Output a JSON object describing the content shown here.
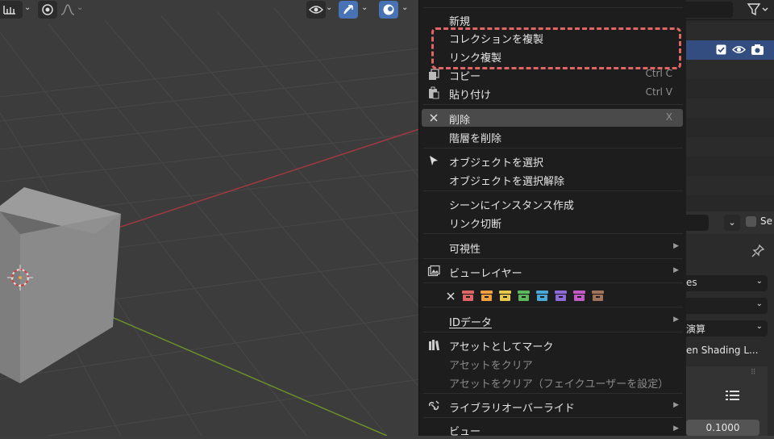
{
  "viewport_header": {
    "icons": [
      "view-icon",
      "chevron-down-icon",
      "gizmo-icon",
      "chevron-down-icon",
      "overlay-icon",
      "chevron-down-icon",
      "proportional-edit-icon",
      "falloff-icon",
      "snapping-icon"
    ]
  },
  "context_menu": {
    "items": {
      "new": {
        "label": "新規"
      },
      "copy_collection": {
        "label": "コレクションを複製"
      },
      "link_duplicate": {
        "label": "リンク複製"
      },
      "copy": {
        "label": "コピー",
        "shortcut": "Ctrl C"
      },
      "paste": {
        "label": "貼り付け",
        "shortcut": "Ctrl V"
      },
      "delete": {
        "label": "削除",
        "shortcut": "X"
      },
      "delete_hierarchy": {
        "label": "階層を削除"
      },
      "select_objects": {
        "label": "オブジェクトを選択"
      },
      "deselect_objects": {
        "label": "オブジェクトを選択解除"
      },
      "instance_to_scene": {
        "label": "シーンにインスタンス作成"
      },
      "unlink": {
        "label": "リンク切断"
      },
      "visibility": {
        "label": "可視性"
      },
      "view_layer": {
        "label": "ビューレイヤー"
      },
      "id_data": {
        "label": "IDデータ"
      },
      "mark_as_asset": {
        "label": "アセットとしてマーク"
      },
      "clear_asset": {
        "label": "アセットをクリア"
      },
      "clear_asset_fake_user": {
        "label": "アセットをクリア（フェイクユーザーを設定）"
      },
      "library_override": {
        "label": "ライブラリオーバーライド"
      },
      "view": {
        "label": "ビュー"
      }
    },
    "color_tags": [
      "#e06666",
      "#f0a040",
      "#e6c84a",
      "#5cb85c",
      "#4aa8d8",
      "#8e6ad8",
      "#c25ac8",
      "#a0745a"
    ]
  },
  "outliner": {
    "row_icons": [
      "checkbox-icon",
      "eye-icon",
      "camera-icon"
    ]
  },
  "properties": {
    "checkbox_label": "Se",
    "dropdown1": "es",
    "dropdown3": "演算",
    "shading_label": "en Shading L...",
    "value_field": "0.1000"
  }
}
